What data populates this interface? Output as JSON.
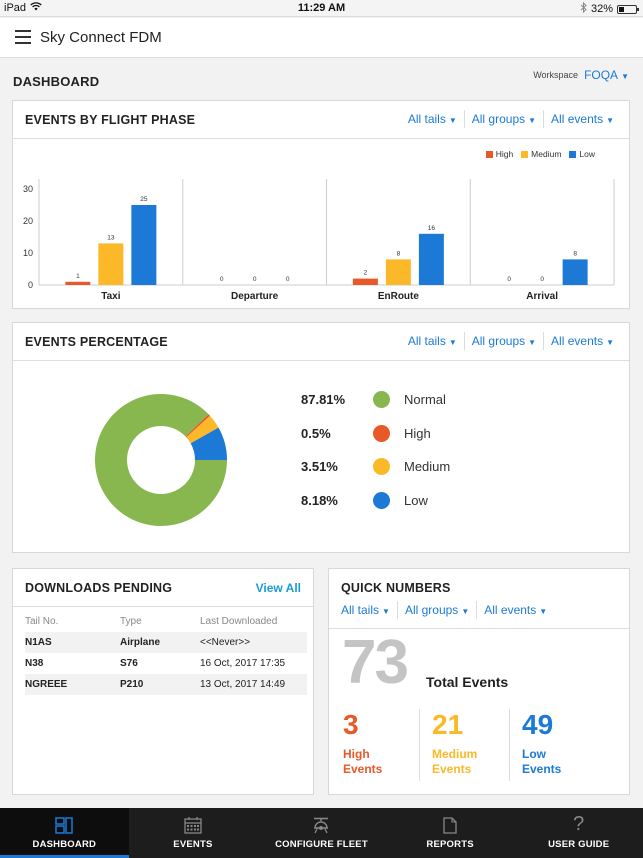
{
  "status_bar": {
    "device": "iPad",
    "time": "11:29 AM",
    "battery": "32%",
    "battery_level": 0.32
  },
  "app": {
    "title": "Sky Connect FDM"
  },
  "page": {
    "title": "DASHBOARD",
    "workspace_label": "Workspace",
    "workspace_value": "FOQA"
  },
  "filters": {
    "tails": "All tails",
    "groups": "All groups",
    "events": "All events"
  },
  "colors": {
    "high": "#e8592a",
    "medium": "#fbb829",
    "low": "#1c7ad6",
    "normal": "#88b74f",
    "accent": "#1c7ad6"
  },
  "events_by_phase": {
    "title": "EVENTS BY FLIGHT PHASE"
  },
  "events_percentage": {
    "title": "EVENTS PERCENTAGE"
  },
  "chart_data": [
    {
      "type": "bar",
      "title": "EVENTS BY FLIGHT PHASE",
      "categories": [
        "Taxi",
        "Departure",
        "EnRoute",
        "Arrival"
      ],
      "series": [
        {
          "name": "High",
          "color": "#e8592a",
          "values": [
            1,
            0,
            2,
            0
          ]
        },
        {
          "name": "Medium",
          "color": "#fbb829",
          "values": [
            13,
            0,
            8,
            0
          ]
        },
        {
          "name": "Low",
          "color": "#1c7ad6",
          "values": [
            25,
            0,
            16,
            8
          ]
        }
      ],
      "yticks": [
        0,
        10,
        20,
        30
      ],
      "ylim": [
        0,
        30
      ],
      "xlabel": "",
      "ylabel": "",
      "legend": "top-right",
      "grid": false
    },
    {
      "type": "pie",
      "title": "EVENTS PERCENTAGE",
      "donut": true,
      "slices": [
        {
          "label": "Low",
          "value": 8.18,
          "display": "8.18%",
          "color": "#1c7ad6"
        },
        {
          "label": "Medium",
          "value": 3.51,
          "display": "3.51%",
          "color": "#fbb829"
        },
        {
          "label": "High",
          "value": 0.5,
          "display": "0.5%",
          "color": "#e8592a"
        },
        {
          "label": "Normal",
          "value": 87.81,
          "display": "87.81%",
          "color": "#88b74f"
        }
      ],
      "legend_order": [
        "Normal",
        "High",
        "Medium",
        "Low"
      ],
      "legend": "right"
    }
  ],
  "downloads": {
    "title": "DOWNLOADS PENDING",
    "view_all": "View All",
    "columns": [
      "Tail No.",
      "Type",
      "Last Downloaded"
    ],
    "rows": [
      [
        "N1AS",
        "Airplane",
        "<<Never>>"
      ],
      [
        "N38",
        "S76",
        "16 Oct, 2017 17:35"
      ],
      [
        "NGREEE",
        "P210",
        "13 Oct, 2017 14:49"
      ]
    ]
  },
  "quick_numbers": {
    "title": "QUICK NUMBERS",
    "total": "73",
    "total_label": "Total Events",
    "stats": [
      {
        "value": "3",
        "label": "High Events"
      },
      {
        "value": "21",
        "label": "Medium Events"
      },
      {
        "value": "49",
        "label": "Low Events"
      }
    ]
  },
  "tabbar": {
    "tabs": [
      {
        "label": "DASHBOARD",
        "icon": "dashboard-icon",
        "active": true
      },
      {
        "label": "EVENTS",
        "icon": "calendar-icon",
        "active": false
      },
      {
        "label": "CONFIGURE FLEET",
        "icon": "helicopter-icon",
        "active": false
      },
      {
        "label": "REPORTS",
        "icon": "document-icon",
        "active": false
      },
      {
        "label": "USER GUIDE",
        "icon": "question-icon",
        "active": false
      }
    ]
  }
}
